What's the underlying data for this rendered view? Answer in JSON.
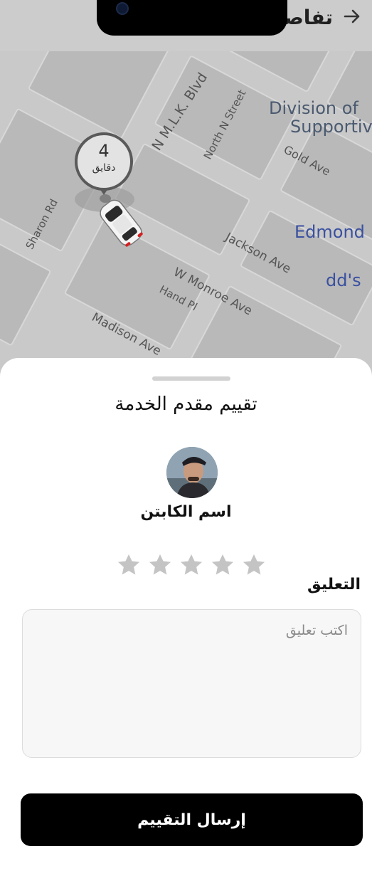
{
  "header": {
    "title": "تفاصيل",
    "back_icon": "arrow-right-icon"
  },
  "map": {
    "streets": [
      "N M.L.K. Blvd",
      "North N Street",
      "Gold Ave",
      "Sharon Rd",
      "Jackson Ave",
      "W Monroe Ave",
      "Hand Pl",
      "Madison Ave"
    ],
    "pois": [
      {
        "text": "Division of",
        "color": "#4a5a70"
      },
      {
        "text": "Supportiv",
        "color": "#4a5a70"
      },
      {
        "text": "Edmond",
        "color": "#3a50a0"
      },
      {
        "text": "dd's",
        "color": "#3a50a0"
      }
    ],
    "eta": {
      "value": "4",
      "unit": "دقايق"
    }
  },
  "sheet": {
    "title": "تقييم مقدم الخدمة",
    "captain_name": "اسم الكابتن",
    "rating": {
      "max": 5,
      "value": 0,
      "empty_color": "#c4c4c4"
    },
    "comment_label": "التعليق",
    "comment_placeholder": "اكتب تعليق",
    "comment_value": "",
    "submit_label": "إرسال التقييم"
  }
}
